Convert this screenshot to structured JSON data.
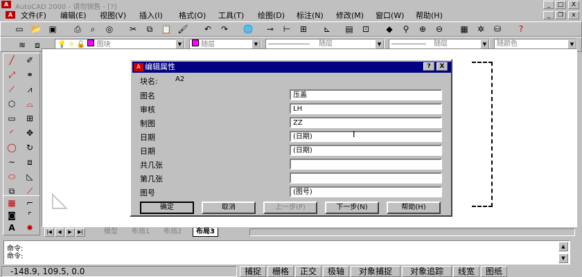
{
  "window": {
    "title": "AutoCAD 2000 - 请勿销售 - [?]",
    "app_icon": "autocad-logo",
    "min_btn": "_",
    "max_btn": "□",
    "close_btn": "X"
  },
  "menu": [
    {
      "label": "文件(F)"
    },
    {
      "label": "编辑(E)"
    },
    {
      "label": "视图(V)"
    },
    {
      "label": "插入(I)"
    },
    {
      "label": "格式(O)"
    },
    {
      "label": "工具(T)"
    },
    {
      "label": "绘图(D)"
    },
    {
      "label": "标注(N)"
    },
    {
      "label": "修改(M)"
    },
    {
      "label": "窗口(W)"
    },
    {
      "label": "帮助(H)"
    }
  ],
  "layer_toolbar": {
    "layer": "图块",
    "color": "随层",
    "linetype": "随层",
    "lineweight": "随层",
    "plotstyle": "随颜色"
  },
  "dialog": {
    "title": "编辑属性",
    "help_btn": "?",
    "close_btn": "X",
    "block_label": "块名:",
    "block_value": "A2",
    "fields": [
      {
        "label": "图名",
        "value": "压盖"
      },
      {
        "label": "审核",
        "value": "LH"
      },
      {
        "label": "制图",
        "value": "ZZ"
      },
      {
        "label": "日期",
        "value": "(日期)"
      },
      {
        "label": "日期",
        "value": "(日期)"
      },
      {
        "label": "共几张",
        "value": ""
      },
      {
        "label": "第几张",
        "value": ""
      },
      {
        "label": "图号",
        "value": "(图号)"
      }
    ],
    "buttons": {
      "ok": "确定",
      "cancel": "取消",
      "prev": "上一步(P)",
      "next": "下一步(N)",
      "help": "帮助(H)"
    }
  },
  "tabs": {
    "model": "模型",
    "layout1": "布局1",
    "layout2": "布局2",
    "layout3": "布局3"
  },
  "command": {
    "line1": "命令:",
    "line2": "命令:"
  },
  "status": {
    "coords": "-148.9, 109.5, 0.0",
    "buttons": [
      "捕捉",
      "栅格",
      "正交",
      "极轴",
      "对象捕捉",
      "对象追踪",
      "线宽",
      "图纸"
    ]
  }
}
